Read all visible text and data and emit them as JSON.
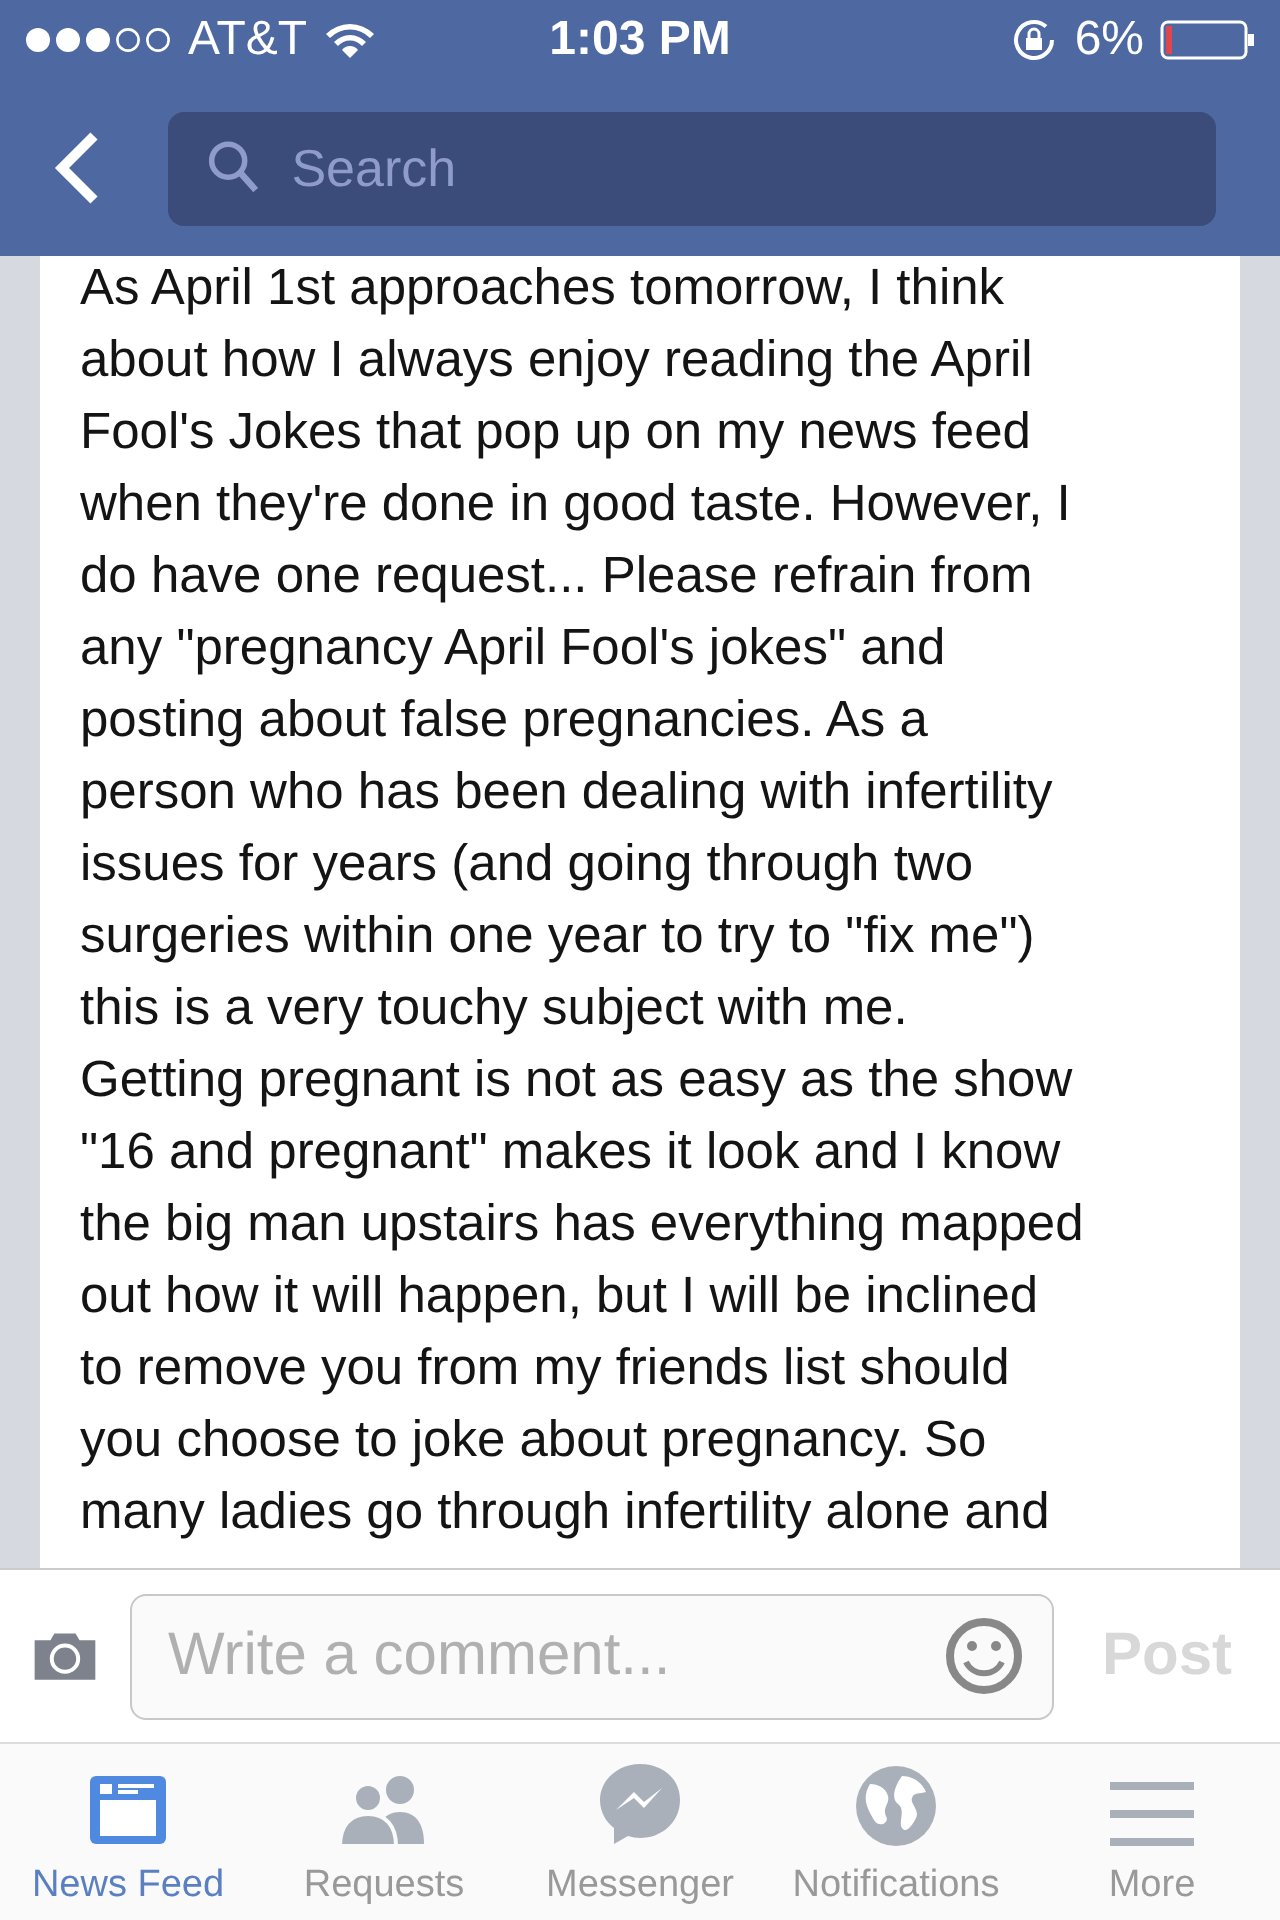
{
  "status_bar": {
    "carrier": "AT&T",
    "time": "1:03 PM",
    "battery": "6%"
  },
  "search": {
    "placeholder": "Search"
  },
  "post": {
    "lines": [
      "As April 1st approaches tomorrow, I think",
      "about how I always enjoy reading the April",
      "Fool's Jokes that pop up on my news feed",
      "when they're done in good taste. However, I",
      "do have one request... Please refrain from",
      "any \"pregnancy April Fool's jokes\" and",
      "posting about false pregnancies. As a",
      "person who has been dealing with infertility",
      "issues for years (and going through two",
      "surgeries within one year to try to \"fix me\")",
      "this is a very touchy subject with me.",
      "Getting pregnant is not as easy as the show",
      "\"16 and pregnant\" makes it look and I know",
      "the big man upstairs has everything mapped",
      "out how it will happen, but I will be inclined",
      "to remove you from my friends list should",
      "you choose to joke about pregnancy. So",
      "many ladies go through infertility alone and"
    ]
  },
  "comment": {
    "placeholder": "Write a comment...",
    "post_button": "Post",
    "post_disabled": true
  },
  "tabs": [
    {
      "kind": "feed",
      "label": "News Feed",
      "selected": true
    },
    {
      "kind": "requests",
      "label": "Requests",
      "selected": false
    },
    {
      "kind": "messenger",
      "label": "Messenger",
      "selected": false
    },
    {
      "kind": "notifications",
      "label": "Notifications",
      "selected": false
    },
    {
      "kind": "more",
      "label": "More",
      "selected": false
    }
  ]
}
